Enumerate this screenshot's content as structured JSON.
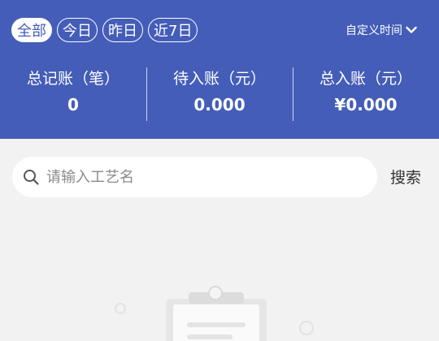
{
  "filters": {
    "chips": [
      "全部",
      "今日",
      "昨日",
      "近7日"
    ],
    "active_index": 0,
    "custom_time_label": "自定义时间"
  },
  "stats": [
    {
      "label": "总记账（笔）",
      "value": "0"
    },
    {
      "label": "待入账（元）",
      "value": "0.000"
    },
    {
      "label": "总入账（元）",
      "value": "¥0.000"
    }
  ],
  "search": {
    "placeholder": "请输入工艺名",
    "value": "",
    "button_label": "搜索"
  },
  "colors": {
    "header_bg": "#445db8",
    "page_bg": "#f2f2f2"
  },
  "icons": {
    "search": "search-icon",
    "dropdown": "chevron-down-icon",
    "empty_state": "clipboard-icon"
  }
}
